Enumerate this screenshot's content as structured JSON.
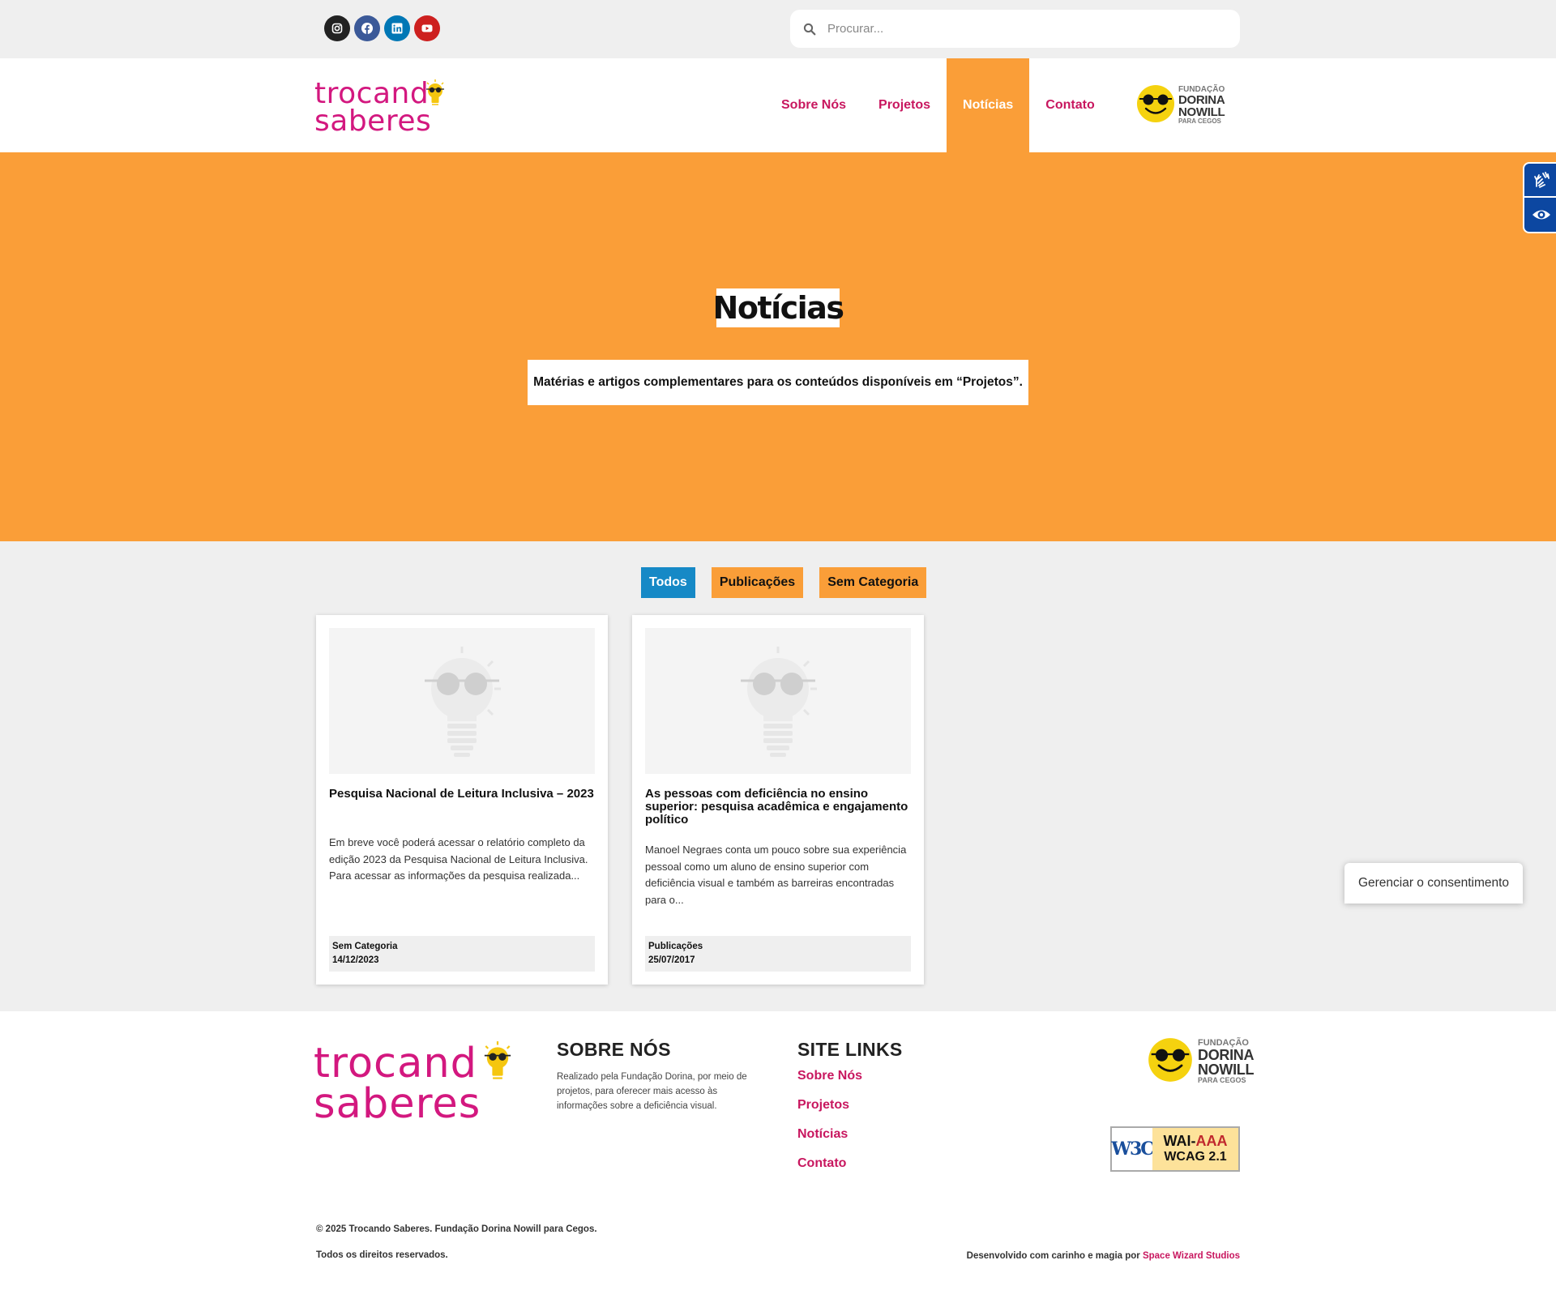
{
  "topbar": {
    "socials": [
      {
        "icon": "instagram-icon",
        "color": "#222222"
      },
      {
        "icon": "facebook-icon",
        "color": "#3b5998"
      },
      {
        "icon": "linkedin-icon",
        "color": "#0077b5"
      },
      {
        "icon": "youtube-icon",
        "color": "#cd201f"
      }
    ],
    "search_placeholder": "Procurar..."
  },
  "header": {
    "logo_line1": "trocand",
    "logo_line2": "saberes",
    "nav": [
      "Sobre Nós",
      "Projetos",
      "Notícias",
      "Contato"
    ],
    "active_nav": "Notícias",
    "fdn_logo": {
      "line1": "FUNDAÇÃO",
      "line2": "DORINA",
      "line3": "NOWILL",
      "line4": "PARA CEGOS"
    }
  },
  "hero": {
    "title": "Notícias",
    "subtitle": "Matérias e artigos complementares para os conteúdos disponíveis em “Projetos”."
  },
  "filters": [
    "Todos",
    "Publicações",
    "Sem Categoria"
  ],
  "active_filter": "Todos",
  "posts": [
    {
      "title": "Pesquisa Nacional de Leitura Inclusiva – 2023",
      "excerpt": "Em breve você poderá acessar o relatório completo da edição 2023 da Pesquisa Nacional de Leitura Inclusiva.   Para acessar as informações da pesquisa realizada...",
      "category": "Sem Categoria",
      "date": "14/12/2023"
    },
    {
      "title": "As pessoas com deficiência no ensino superior: pesquisa acadêmica e engajamento político",
      "excerpt": "Manoel Negraes conta um pouco sobre sua experiência pessoal como um aluno de ensino superior com deficiência visual e também as barreiras encontradas para o...",
      "category": "Publicações",
      "date": "25/07/2017"
    }
  ],
  "consent_button": "Gerenciar o consentimento",
  "footer": {
    "about_title": "SOBRE NÓS",
    "about_text": "Realizado pela Fundação Dorina, por meio de projetos, para oferecer mais acesso às informações sobre a deficiência visual.",
    "links_title": "SITE LINKS",
    "links": [
      "Sobre Nós",
      "Projetos",
      "Notícias",
      "Contato"
    ],
    "badge_logo": "W3C",
    "badge_line1_prefix": "WAI-",
    "badge_line1_level": "AAA",
    "badge_line2": "WCAG 2.1",
    "copyright": "© 2025 Trocando Saberes. Fundação Dorina Nowill para Cegos.",
    "rights": "Todos os direitos reservados.",
    "credit_prefix": "Desenvolvido com carinho e magia por",
    "credit_link": "Space Wizard Studios"
  },
  "colors": {
    "brand_pink": "#d3187f",
    "nav_pink": "#c8175f",
    "orange": "#fa9e38",
    "blue_active": "#1689c6",
    "a11y_blue": "#0c47a1",
    "background_grey": "#efefef"
  }
}
